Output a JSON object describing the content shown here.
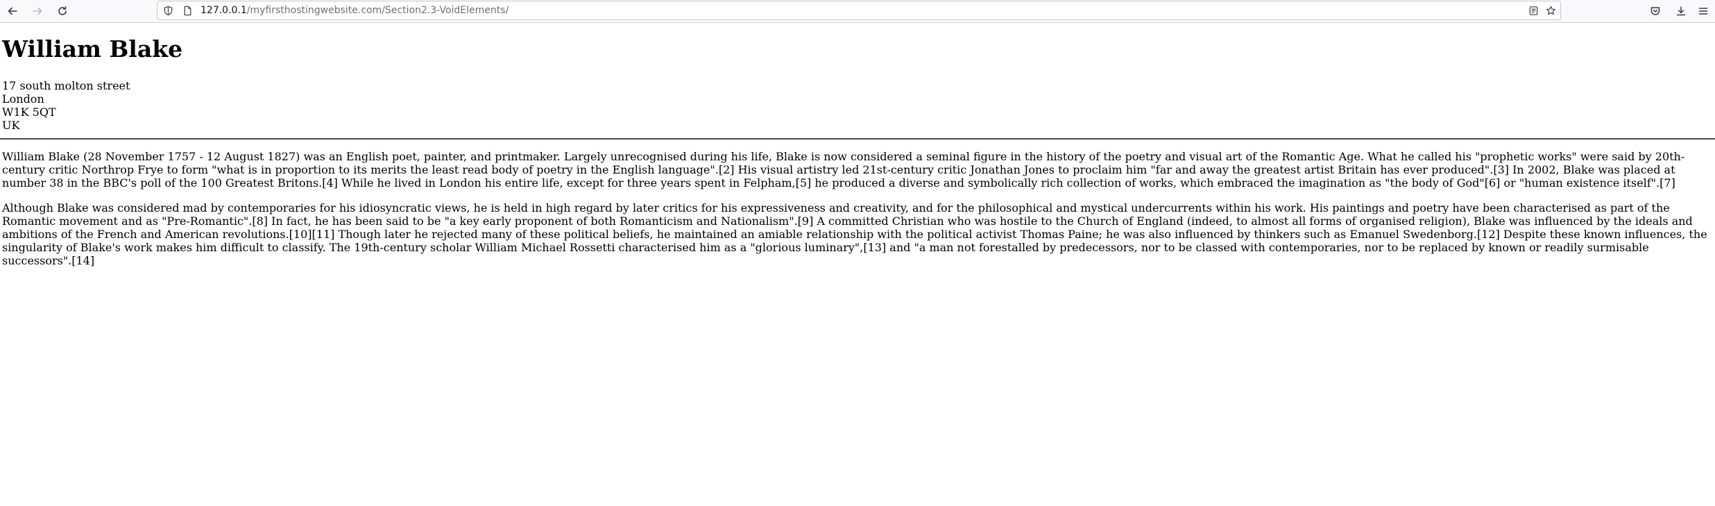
{
  "browser": {
    "url_host": "127.0.0.1",
    "url_path": "/myfirsthostingwebsite.com/Section2.3-VoidElements/",
    "icons": [
      "back-arrow-icon",
      "forward-arrow-icon",
      "reload-icon",
      "shield-icon",
      "page-info-icon",
      "reader-view-icon",
      "bookmark-star-icon",
      "pocket-icon",
      "download-icon",
      "menu-icon"
    ]
  },
  "page": {
    "title": "William Blake",
    "address": [
      "17 south molton street",
      "London",
      "W1K 5QT",
      "UK"
    ],
    "paragraphs": [
      "William Blake (28 November 1757 - 12 August 1827) was an English poet, painter, and printmaker. Largely unrecognised during his life, Blake is now considered a seminal figure in the history of the poetry and visual art of the Romantic Age. What he called his \"prophetic works\" were said by 20th-century critic Northrop Frye to form \"what is in proportion to its merits the least read body of poetry in the English language\".[2] His visual artistry led 21st-century critic Jonathan Jones to proclaim him \"far and away the greatest artist Britain has ever produced\".[3] In 2002, Blake was placed at number 38 in the BBC's poll of the 100 Greatest Britons.[4] While he lived in London his entire life, except for three years spent in Felpham,[5] he produced a diverse and symbolically rich collection of works, which embraced the imagination as \"the body of God\"[6] or \"human existence itself\".[7]",
      "Although Blake was considered mad by contemporaries for his idiosyncratic views, he is held in high regard by later critics for his expressiveness and creativity, and for the philosophical and mystical undercurrents within his work. His paintings and poetry have been characterised as part of the Romantic movement and as \"Pre-Romantic\".[8] In fact, he has been said to be \"a key early proponent of both Romanticism and Nationalism\".[9] A committed Christian who was hostile to the Church of England (indeed, to almost all forms of organised religion), Blake was influenced by the ideals and ambitions of the French and American revolutions.[10][11] Though later he rejected many of these political beliefs, he maintained an amiable relationship with the political activist Thomas Paine; he was also influenced by thinkers such as Emanuel Swedenborg.[12] Despite these known influences, the singularity of Blake's work makes him difficult to classify. The 19th-century scholar William Michael Rossetti characterised him as a \"glorious luminary\",[13] and \"a man not forestalled by predecessors, nor to be classed with contemporaries, nor to be replaced by known or readily surmisable successors\".[14]"
    ]
  }
}
